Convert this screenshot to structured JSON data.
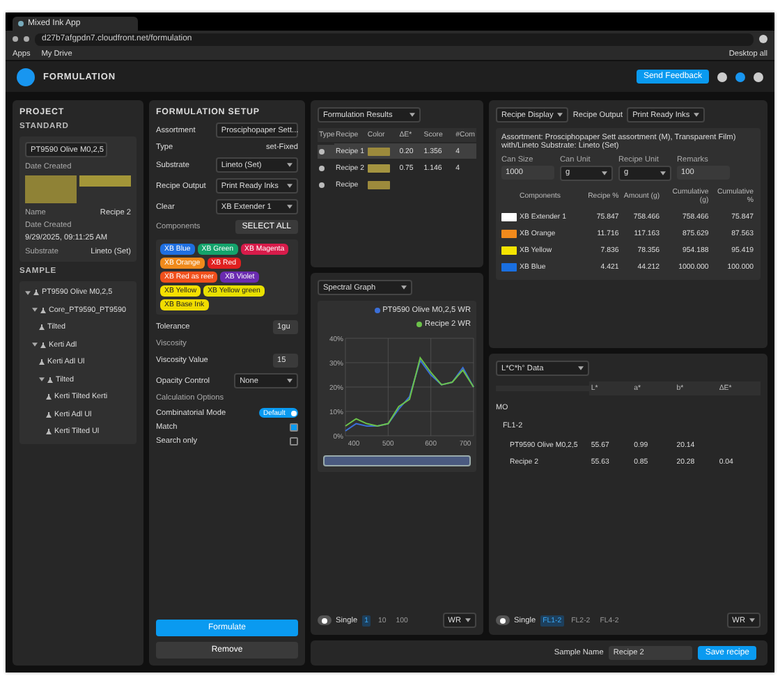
{
  "browser": {
    "tab_title": "Mixed Ink App",
    "url": "d27b7afgpdn7.cloudfront.net/formulation",
    "bookmarks": [
      "Apps",
      "My Drive"
    ],
    "profile_label": "Desktop all"
  },
  "app": {
    "title": "FORMULATION",
    "feedback_button": "Send Feedback"
  },
  "project": {
    "title": "PROJECT",
    "standard": {
      "heading": "STANDARD",
      "select": "PT9590 Olive M0,2,5",
      "date_label": "Date Created",
      "swatches": [
        {
          "color": "#8f8236"
        },
        {
          "color": "#a39638"
        }
      ],
      "fields": [
        {
          "label": "Name",
          "value": "Recipe 2"
        },
        {
          "label": "Date Created",
          "value": "9/29/2025, 09:11:25 AM"
        },
        {
          "label": "Substrate",
          "value": "Lineto (Set)"
        }
      ]
    },
    "sample": {
      "heading": "SAMPLE",
      "tree": [
        {
          "label": "PT9590 Olive M0,2,5",
          "children": [
            {
              "label": "Core_PT9590_PT9590",
              "children": [
                {
                  "label": "Tilted"
                }
              ]
            },
            {
              "label": "Kerti Adl",
              "children": [
                {
                  "label": "Kerti Adl Ul"
                },
                {
                  "label": "Tilted",
                  "children": [
                    {
                      "label": "Kerti Tilted Kerti"
                    },
                    {
                      "label": "Kerti Adl Ul"
                    },
                    {
                      "label": "Kerti Tilted Ul"
                    }
                  ]
                }
              ]
            }
          ]
        }
      ]
    }
  },
  "setup": {
    "title": "FORMULATION SETUP",
    "fields": [
      {
        "kind": "select",
        "label": "Assortment",
        "value": "Prosciphopaper Sett..."
      },
      {
        "kind": "text",
        "label": "Type",
        "value": "set-Fixed"
      },
      {
        "kind": "select",
        "label": "Substrate",
        "value": "Lineto (Set)"
      },
      {
        "kind": "select",
        "label": "Recipe Output",
        "value": "Print Ready Inks"
      },
      {
        "kind": "select",
        "label": "Clear",
        "value": "XB Extender 1"
      }
    ],
    "components_label": "Components",
    "select_all": "SELECT ALL",
    "chips": [
      {
        "label": "XB Blue",
        "color": "#1f6fe0"
      },
      {
        "label": "XB Green",
        "color": "#13a36b"
      },
      {
        "label": "XB Magenta",
        "color": "#d81b4a"
      },
      {
        "label": "XB Orange",
        "color": "#f08a1c"
      },
      {
        "label": "XB Red",
        "color": "#e02020"
      },
      {
        "label": "XB Red as reer",
        "color": "#f0501c"
      },
      {
        "label": "XB Violet",
        "color": "#6a2bb0"
      },
      {
        "label": "XB Yellow",
        "color": "#f5e000"
      },
      {
        "label": "XB Yellow green",
        "color": "#e8e000"
      },
      {
        "label": "XB Base Ink",
        "color": "#f0dc00"
      }
    ],
    "tolerance": {
      "label": "Tolerance",
      "value": "1gu"
    },
    "viscosity": {
      "label": "Viscosity",
      "value_label": "Viscosity Value",
      "value": "15"
    },
    "opacity": {
      "label": "Opacity Control",
      "value": "None"
    },
    "calc": {
      "label": "Calculation Options",
      "options": [
        {
          "kind": "toggle",
          "label": "Combinatorial Mode",
          "value": "Default",
          "on": true
        },
        {
          "kind": "checkbox",
          "label": "Match",
          "checked": true
        },
        {
          "kind": "checkbox",
          "label": "Search only",
          "checked": false
        }
      ]
    },
    "formulate": "Formulate",
    "remove": "Remove"
  },
  "results": {
    "title": "Formulation Results",
    "columns": [
      "Type",
      "Recipe",
      "Color",
      "ΔE*",
      "Score",
      "#Com"
    ],
    "rows": [
      {
        "recipe": "Recipe 1",
        "color": "#9c8a3c",
        "de": "0.20",
        "score": "1.356",
        "count": "4",
        "selected": true
      },
      {
        "recipe": "Recipe 2",
        "color": "#a49440",
        "de": "0.75",
        "score": "1.146",
        "count": "4",
        "selected": false
      },
      {
        "recipe": "Recipe",
        "color": "#9c8a3c",
        "selected": false
      }
    ]
  },
  "graph": {
    "title": "Spectral Graph",
    "single": {
      "label": "Single",
      "on": false
    },
    "steps": [
      "1",
      "10",
      "100"
    ],
    "mode": "WR",
    "chart_data": {
      "type": "line",
      "x": [
        400,
        425,
        450,
        475,
        500,
        525,
        550,
        575,
        600,
        625,
        650,
        675,
        700
      ],
      "xlim": [
        400,
        700
      ],
      "grid": true,
      "xticks": [
        400,
        500,
        600,
        700
      ],
      "yticks": [
        {
          "value": 0,
          "label": "0%"
        },
        {
          "value": 10,
          "label": "10%"
        },
        {
          "value": 20,
          "label": "20%"
        },
        {
          "value": 30,
          "label": "30%"
        },
        {
          "value": 40,
          "label": "40%"
        }
      ],
      "ylim": [
        0,
        40
      ],
      "series": [
        {
          "name": "PT9590 Olive M0,2,5 WR",
          "color": "#3b6fd8",
          "values": [
            2,
            5,
            4,
            4,
            5,
            11,
            16,
            31,
            25,
            21,
            22,
            28,
            20
          ]
        },
        {
          "name": "Recipe 2 WR",
          "color": "#6cc24a",
          "values": [
            4,
            7,
            5,
            4,
            5,
            12,
            15,
            32,
            26,
            21,
            22,
            27,
            20
          ]
        }
      ]
    }
  },
  "recipe": {
    "display": "Recipe Display",
    "output_label": "Recipe Output",
    "output": "Print Ready Inks",
    "description": "Assortment: Prosciphopaper Sett assortment (M), Transparent Film) with/Lineto Substrate: Lineto (Set)",
    "inputs": [
      {
        "label": "Can Size",
        "value": "1000",
        "kind": "text"
      },
      {
        "label": "Can Unit",
        "value": "g",
        "kind": "select"
      },
      {
        "label": "Recipe Unit",
        "value": "g",
        "kind": "select"
      },
      {
        "label": "Remarks",
        "value": "100",
        "kind": "text"
      }
    ],
    "columns": [
      "Components",
      "Recipe %",
      "Amount (g)",
      "Cumulative (g)",
      "Cumulative %"
    ],
    "rows": [
      {
        "color": "#ffffff",
        "cells": [
          "XB Extender 1",
          "75.847",
          "758.466",
          "758.466",
          "75.847"
        ]
      },
      {
        "color": "#f28a1c",
        "cells": [
          "XB Orange",
          "11.716",
          "117.163",
          "875.629",
          "87.563"
        ]
      },
      {
        "color": "#f5e400",
        "cells": [
          "XB Yellow",
          "7.836",
          "78.356",
          "954.188",
          "95.419"
        ]
      },
      {
        "color": "#1a6fe0",
        "cells": [
          "XB Blue",
          "4.421",
          "44.212",
          "1000.000",
          "100.000"
        ]
      }
    ]
  },
  "color_data": {
    "select": "L*C*h° Data",
    "columns": [
      "L*",
      "a*",
      "b*",
      "ΔE*"
    ],
    "tree": [
      {
        "label": "MO",
        "children": [
          {
            "label": "FL1-2",
            "children": [
              {
                "label": "PT9590 Olive M0,2,5",
                "values": [
                  "55.67",
                  "0.99",
                  "20.14"
                ]
              },
              {
                "label": "Recipe 2",
                "values": [
                  "55.63",
                  "0.85",
                  "20.28",
                  "0.04"
                ]
              }
            ]
          }
        ]
      }
    ],
    "single": {
      "label": "Single",
      "on": false
    },
    "illuminants": [
      {
        "label": "FL1-2",
        "selected": true
      },
      {
        "label": "FL2-2",
        "selected": false
      },
      {
        "label": "FL4-2",
        "selected": false
      }
    ],
    "mode": "WR"
  },
  "footer": {
    "label": "Sample Name",
    "value": "Recipe 2",
    "button": "Save recipe"
  }
}
